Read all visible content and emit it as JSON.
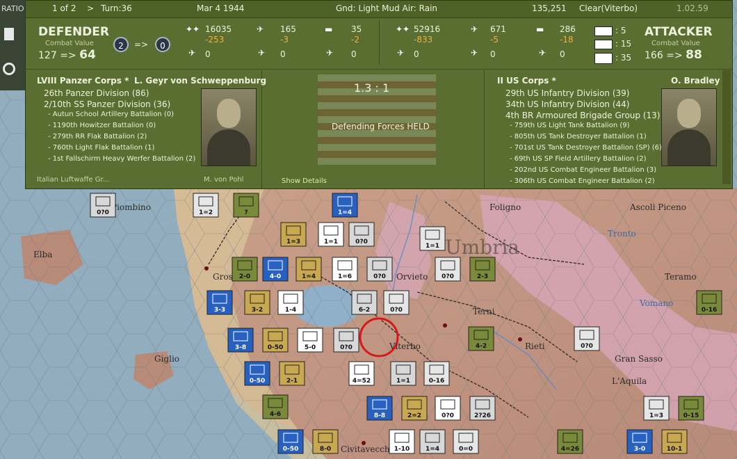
{
  "topbar": {
    "page": "1 of 2",
    "next": ">",
    "turn": "Turn:36",
    "date": "Mar 4 1944",
    "weather": "Gnd: Light Mud  Air: Rain",
    "score": "135,251",
    "location": "Clear(Viterbo)",
    "version": "1.02.59"
  },
  "defender": {
    "title": "DEFENDER",
    "cv_label": "Combat Value",
    "cv_from": "127",
    "arrow": "=>",
    "cv_to": "64",
    "rating_from": "2",
    "rating_to": "0",
    "men": "16035",
    "men_loss": "-253",
    "guns": "165",
    "guns_loss": "-3",
    "tanks": "35",
    "tanks_loss": "-2",
    "air1": "0",
    "air2": "0",
    "air3": "0",
    "commander_corps": "LVIII Panzer Corps *",
    "commander_name": "L. Geyr von Schweppenburg",
    "units": [
      "26th Panzer Division (86)",
      "2/10th SS Panzer Division (36)",
      "- Autun School Artillery Battalion (0)",
      "- 1190th Howitzer Battalion (0)",
      "- 279th RR Flak Battalion (2)",
      "- 760th Light Flak Battalion (1)",
      "- 1st Fallschirm Heavy Werfer Battalion (2)"
    ],
    "cutoff_left": "Italian Luftwaffe Gr...",
    "cutoff_right": "M. von Pohl"
  },
  "attacker": {
    "title": "ATTACKER",
    "cv_label": "Combat Value",
    "cv_from": "166",
    "arrow": "=>",
    "cv_to": "88",
    "men": "52916",
    "men_loss": "-833",
    "guns": "671",
    "guns_loss": "-5",
    "tanks": "286",
    "tanks_loss": "-18",
    "air1": "0",
    "air2": "0",
    "air3": "0",
    "mod1": ": 5",
    "mod2": ": 15",
    "mod3": ": 35",
    "commander_corps": "II US Corps *",
    "commander_name": "O. Bradley",
    "units": [
      "29th US Infantry Division (39)",
      "34th US Infantry Division (44)",
      "4th BR Armoured Brigade Group (13)",
      "- 759th US Light Tank Battalion (9)",
      "- 805th US Tank Destroyer Battalion (1)",
      "- 701st US Tank Destroyer Battalion (SP) (6)",
      "- 69th US SP Field Artillery Battalion (2)",
      "- 202nd US Combat Engineer Battalion (3)",
      "- 306th US Combat Engineer Battalion (2)"
    ]
  },
  "result": {
    "odds": "1.3 : 1",
    "outcome": "Defending Forces HELD",
    "details_link": "Show Details"
  },
  "left_strip": {
    "label": "RATIO"
  },
  "map_labels": [
    "Elba",
    "Giglio",
    "Umbria",
    "Foligno",
    "Ascoli Piceno",
    "Teramo",
    "Terni",
    "Rieti",
    "L'Aquila",
    "Viterbo",
    "Piombino",
    "Orvieto",
    "Tronto",
    "Vomano",
    "Gran Sasso",
    "Civitavecchia",
    "Grosseto"
  ],
  "counters": [
    {
      "label": "0?0"
    },
    {
      "label": "1=2"
    },
    {
      "label": "?"
    },
    {
      "label": "1=4"
    },
    {
      "label": "1=3"
    },
    {
      "label": "1=1"
    },
    {
      "label": "0?0"
    },
    {
      "label": "1=1"
    },
    {
      "label": "2-0"
    },
    {
      "label": "4-0"
    },
    {
      "label": "1=4"
    },
    {
      "label": "1=6"
    },
    {
      "label": "0?0"
    },
    {
      "label": "0?0"
    },
    {
      "label": "2-3"
    },
    {
      "label": "3-3"
    },
    {
      "label": "3-2"
    },
    {
      "label": "1-4"
    },
    {
      "label": "6-2"
    },
    {
      "label": "0?0"
    },
    {
      "label": "4-2"
    },
    {
      "label": "3-8"
    },
    {
      "label": "0-50"
    },
    {
      "label": "5-0"
    },
    {
      "label": "0?0"
    },
    {
      "label": "0?0"
    },
    {
      "label": "0-16"
    },
    {
      "label": "0-50"
    },
    {
      "label": "2-1"
    },
    {
      "label": "4=52"
    },
    {
      "label": "1=1"
    },
    {
      "label": "0-16"
    },
    {
      "label": "4-6"
    },
    {
      "label": "8-8"
    },
    {
      "label": "2=2"
    },
    {
      "label": "0?0"
    },
    {
      "label": "2?26"
    },
    {
      "label": "1=3"
    },
    {
      "label": "0-15"
    },
    {
      "label": "0-50"
    },
    {
      "label": "8-0"
    },
    {
      "label": "1-10"
    },
    {
      "label": "1=4"
    },
    {
      "label": "0=0"
    },
    {
      "label": "4=26"
    },
    {
      "label": "3-0"
    },
    {
      "label": "10-1"
    }
  ]
}
